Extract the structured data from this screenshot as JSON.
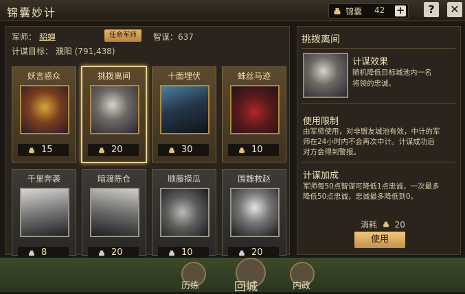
{
  "header": {
    "title": "锦囊妙计",
    "resource_label": "锦囊",
    "resource_value": "42",
    "plus": "+",
    "help": "?",
    "close": "✕"
  },
  "info": {
    "advisor_label": "军师：",
    "advisor_name": "貂蝉",
    "appoint_button": "任命军师",
    "wisdom": "智谋：637",
    "target": "计谋目标：  濮阳 (791,438)"
  },
  "cards": [
    {
      "name": "妖言惑众",
      "cost": "15",
      "state": "gold"
    },
    {
      "name": "挑拨离间",
      "cost": "20",
      "state": "selected"
    },
    {
      "name": "十面埋伏",
      "cost": "30",
      "state": "gold"
    },
    {
      "name": "蛛丝马迹",
      "cost": "10",
      "state": "gold"
    },
    {
      "name": "千里奔袭",
      "cost": "8",
      "state": "gray"
    },
    {
      "name": "暗渡陈仓",
      "cost": "20",
      "state": "gray"
    },
    {
      "name": "顺藤摸瓜",
      "cost": "10",
      "state": "gray"
    },
    {
      "name": "围魏救赵",
      "cost": "20",
      "state": "gray"
    }
  ],
  "detail": {
    "title": "挑拨离间",
    "effect_title": "计谋效果",
    "effect_line1": "随机降低目标城池内一名",
    "effect_line2": "将领的忠诚。",
    "limit_title": "使用限制",
    "limit_line1": "由军师使用，对非盟友城池有效，中计的军",
    "limit_line2": "师在24小时内不会再次中计。计谋成功后",
    "limit_line3": "对方会得到警报。",
    "bonus_title": "计谋加成",
    "bonus_line1": "军师每50点智谋可降低1点忠诚，一次最多",
    "bonus_line2": "降低50点忠诚，忠诚最多降低到0。",
    "consume_label": "消耗",
    "consume_value": "20",
    "use_button": "使用"
  },
  "bottom_nav": {
    "training": "历练",
    "return_city": "回城",
    "internal": "内政"
  },
  "colors": {
    "gold_border": "#e9d28a",
    "button": "#e4b86a",
    "panel": "#2a241c"
  }
}
